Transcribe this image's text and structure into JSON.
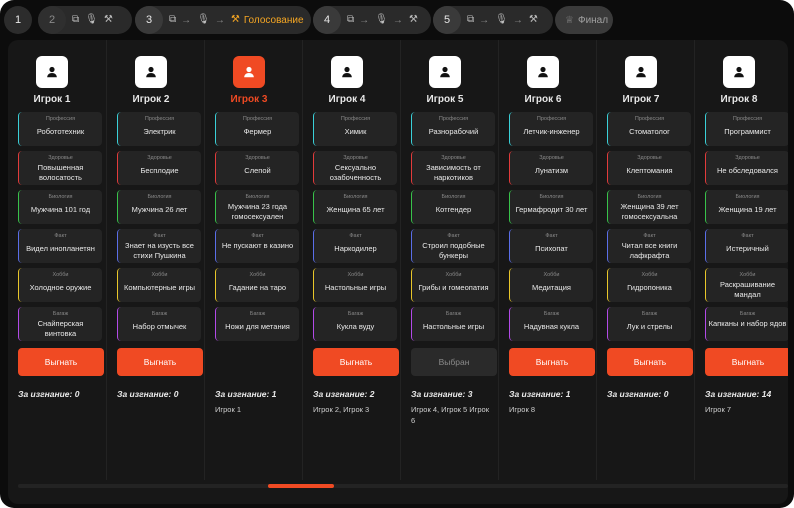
{
  "steps": [
    {
      "num": "1"
    },
    {
      "num": "2",
      "icons": [
        "cards-icon",
        "mic-icon",
        "gavel-icon"
      ]
    },
    {
      "num": "3",
      "icons": [
        "cards-icon",
        "arrow-icon",
        "mic-icon",
        "arrow-icon"
      ],
      "label": "Голосование"
    },
    {
      "num": "4",
      "icons": [
        "cards-icon",
        "arrow-icon",
        "mic-icon",
        "arrow-icon",
        "gavel-icon"
      ]
    },
    {
      "num": "5",
      "icons": [
        "cards-icon",
        "arrow-icon",
        "mic-icon",
        "arrow-icon",
        "gavel-icon"
      ]
    },
    {
      "label": "Финал"
    }
  ],
  "colors": {
    "accent": "#f04a23",
    "vote": "#f5a623"
  },
  "card_labels": {
    "profession": "Профессия",
    "health": "Здоровье",
    "biology": "Биология",
    "fact": "Факт",
    "hobby": "Хобби",
    "baggage": "Багаж"
  },
  "votes_prefix": "За изгнание:",
  "players": [
    {
      "name": "Игрок 1",
      "profession": "Робототехник",
      "health": "Повышенная волосатость",
      "biology": "Мужчина 101 год",
      "fact": "Видел инопланетян",
      "hobby": "Холодное оружие",
      "baggage": "Снайперская винтовка",
      "button": "Выгнать",
      "votes": "0",
      "voters": ""
    },
    {
      "name": "Игрок 2",
      "profession": "Электрик",
      "health": "Бесплодие",
      "biology": "Мужчина 26 лет",
      "fact": "Знает на изусть все стихи Пушкина",
      "hobby": "Компьютерные игры",
      "baggage": "Набор отмычек",
      "button": "Выгнать",
      "votes": "0",
      "voters": ""
    },
    {
      "name": "Игрок 3",
      "profession": "Фермер",
      "health": "Слепой",
      "biology": "Мужчина 23 года гомосексуален",
      "fact": "Не пускают в казино",
      "hobby": "Гадание на таро",
      "baggage": "Ножи для метания",
      "button": "",
      "votes": "1",
      "voters": "Игрок 1"
    },
    {
      "name": "Игрок 4",
      "profession": "Химик",
      "health": "Сексуально озабоченность",
      "biology": "Женщина 65 лет",
      "fact": "Наркодилер",
      "hobby": "Настольные игры",
      "baggage": "Кукла вуду",
      "button": "Выгнать",
      "votes": "2",
      "voters": "Игрок 2, Игрок 3"
    },
    {
      "name": "Игрок 5",
      "profession": "Разнорабочий",
      "health": "Зависимость от наркотиков",
      "biology": "Котгендер",
      "fact": "Строил подобные бункеры",
      "hobby": "Грибы и гомеопатия",
      "baggage": "Настольные игры",
      "button": "Выбран",
      "votes": "3",
      "voters": "Игрок 4, Игрок 5 Игрок 6"
    },
    {
      "name": "Игрок 6",
      "profession": "Летчик-инженер",
      "health": "Лунатизм",
      "biology": "Гермафродит 30 лет",
      "fact": "Психопат",
      "hobby": "Медитация",
      "baggage": "Надувная кукла",
      "button": "Выгнать",
      "votes": "1",
      "voters": "Игрок 8"
    },
    {
      "name": "Игрок 7",
      "profession": "Стоматолог",
      "health": "Клептомания",
      "biology": "Женщина 39 лет гомосексуальна",
      "fact": "Читал все книги лафкрафта",
      "hobby": "Гидропоника",
      "baggage": "Лук и стрелы",
      "button": "Выгнать",
      "votes": "0",
      "voters": ""
    },
    {
      "name": "Игрок 8",
      "profession": "Программист",
      "health": "Не обследовался",
      "biology": "Женщина 19 лет",
      "fact": "Истеричный",
      "hobby": "Раскрашивание мандал",
      "baggage": "Капканы и набор ядов",
      "button": "Выгнать",
      "votes": "14",
      "voters": "Игрок 7"
    }
  ]
}
